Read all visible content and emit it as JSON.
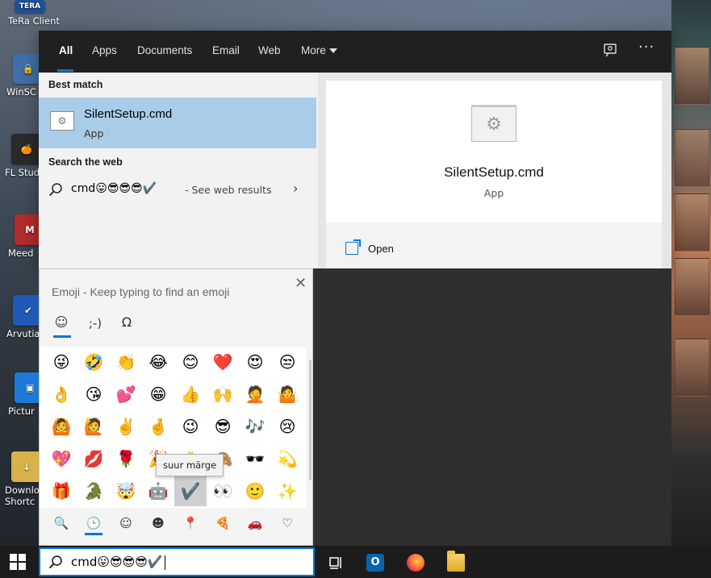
{
  "desktop": {
    "icons": [
      {
        "label": "TeRa Client",
        "glyph": "TERA",
        "color": "#1f4f96"
      },
      {
        "label": "WinSC",
        "glyph": "🔒",
        "color": "#3f6fa6"
      },
      {
        "label": "FL Studi",
        "glyph": "🍊",
        "color": "#2a2a2a"
      },
      {
        "label": "Meed",
        "glyph": "M",
        "color": "#b32b2b"
      },
      {
        "label": "Arvutia",
        "glyph": "✔",
        "color": "#1f5ab8"
      },
      {
        "label": "Pictur",
        "glyph": "▣",
        "color": "#1e7ad8"
      },
      {
        "label": "Downloa",
        "label2": "Shortc",
        "glyph": "↓",
        "color": "#d7b24a"
      }
    ]
  },
  "search": {
    "tabs": [
      "All",
      "Apps",
      "Documents",
      "Email",
      "Web",
      "More"
    ],
    "active_tab": "All",
    "best_match_title": "Best match",
    "best_match": {
      "name": "SilentSetup.cmd",
      "type": "App"
    },
    "search_web_title": "Search the web",
    "web_result": {
      "query": "cmd😛😎😎😎✔️",
      "suffix": "- See web results"
    },
    "preview": {
      "name": "SilentSetup.cmd",
      "type": "App"
    },
    "actions": [
      {
        "label": "Open"
      }
    ]
  },
  "emoji_panel": {
    "title": "Emoji - Keep typing to find an emoji",
    "category_tabs": [
      "☺",
      ";-)",
      "Ω"
    ],
    "grid": [
      [
        "😜",
        "🤣",
        "👏",
        "😂",
        "😊",
        "❤️",
        "😍",
        "😒"
      ],
      [
        "👌",
        "😘",
        "💕",
        "😁",
        "👍",
        "🙌",
        "🤦",
        "🤷"
      ],
      [
        "🙆",
        "🙋",
        "✌️",
        "🤞",
        "😉",
        "😎",
        "🎶",
        "😢"
      ],
      [
        "💖",
        "💋",
        "🌹",
        "🎉",
        "🎂",
        "🙈",
        "🕶️",
        "💫"
      ],
      [
        "🎁",
        "🐊",
        "🤯",
        "🤖",
        "✔️",
        "👀",
        "🙂",
        "✨"
      ]
    ],
    "selected": {
      "row": 4,
      "col": 4
    },
    "tooltip": "suur märge",
    "footer_categories": [
      "🔍",
      "🕒",
      "☺",
      "☻",
      "📍",
      "🍕",
      "🚗",
      "♡"
    ],
    "active_footer": 1
  },
  "taskbar": {
    "search_text": "cmd😛😎😎😎✔️",
    "outlook_letter": "O"
  }
}
